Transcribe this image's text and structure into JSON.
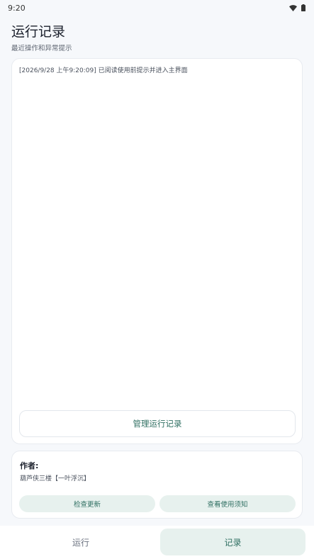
{
  "status_bar": {
    "time": "9:20",
    "icons": [
      "wifi-icon",
      "battery-icon"
    ]
  },
  "header": {
    "title": "运行记录",
    "subtitle": "最近操作和异常提示"
  },
  "log": {
    "entries": [
      "[2026/9/28 上午9:20:09] 已阅读使用前提示并进入主界面"
    ],
    "manage_button": "管理运行记录"
  },
  "author": {
    "label": "作者:",
    "name": "葫芦侠三楼【一叶浮沉】",
    "check_update_button": "检查更新",
    "usage_notes_button": "查看使用须知"
  },
  "bottom_nav": {
    "items": [
      {
        "label": "运行",
        "active": false
      },
      {
        "label": "记录",
        "active": true
      }
    ]
  },
  "colors": {
    "accent": "#2f6f62",
    "accent_bg": "#e7f1ee",
    "background": "#f6f8fb"
  }
}
